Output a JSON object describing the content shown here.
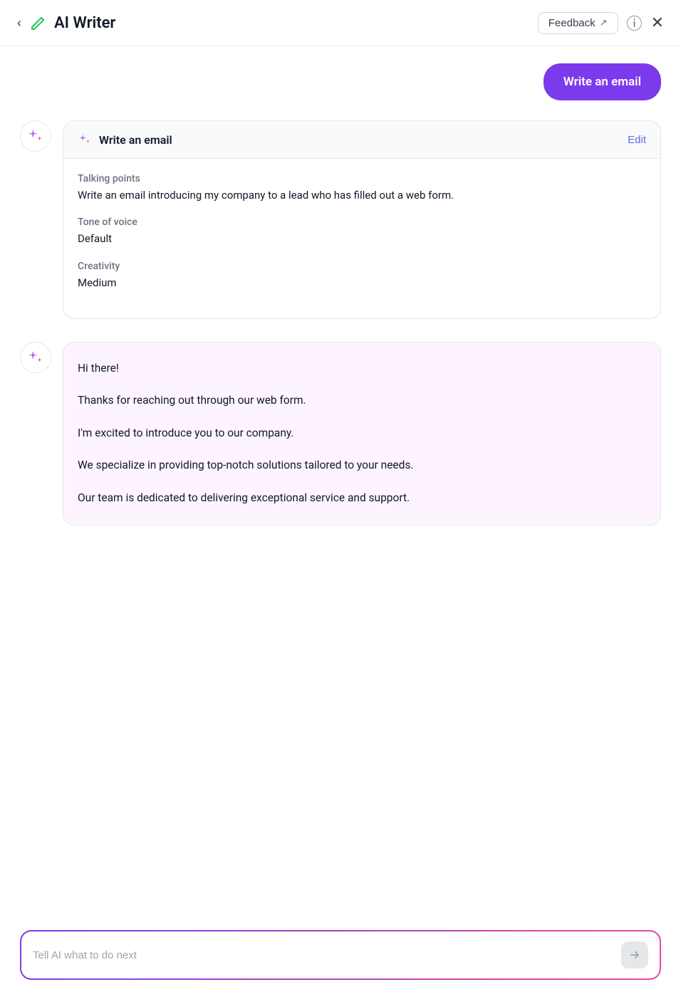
{
  "header": {
    "back_label": "‹",
    "pencil_icon": "✏",
    "title": "AI Writer",
    "feedback_label": "Feedback",
    "feedback_ext_icon": "↗",
    "info_icon": "ⓘ",
    "close_icon": "✕"
  },
  "user_message": {
    "text": "Write an email"
  },
  "prompt_card": {
    "title": "Write an email",
    "edit_label": "Edit",
    "fields": {
      "talking_points_label": "Talking points",
      "talking_points_value": "Write an email introducing my company to a lead who has filled out a web form.",
      "tone_label": "Tone of voice",
      "tone_value": "Default",
      "creativity_label": "Creativity",
      "creativity_value": "Medium"
    }
  },
  "response_card": {
    "paragraphs": [
      "Hi there!",
      "Thanks for reaching out through our web form.",
      "I'm excited to introduce you to our company.",
      "We specialize in providing top-notch solutions tailored to your needs.",
      "Our team is dedicated to delivering exceptional service and support."
    ]
  },
  "input_bar": {
    "placeholder": "Tell AI what to do next",
    "send_icon": "▶"
  }
}
